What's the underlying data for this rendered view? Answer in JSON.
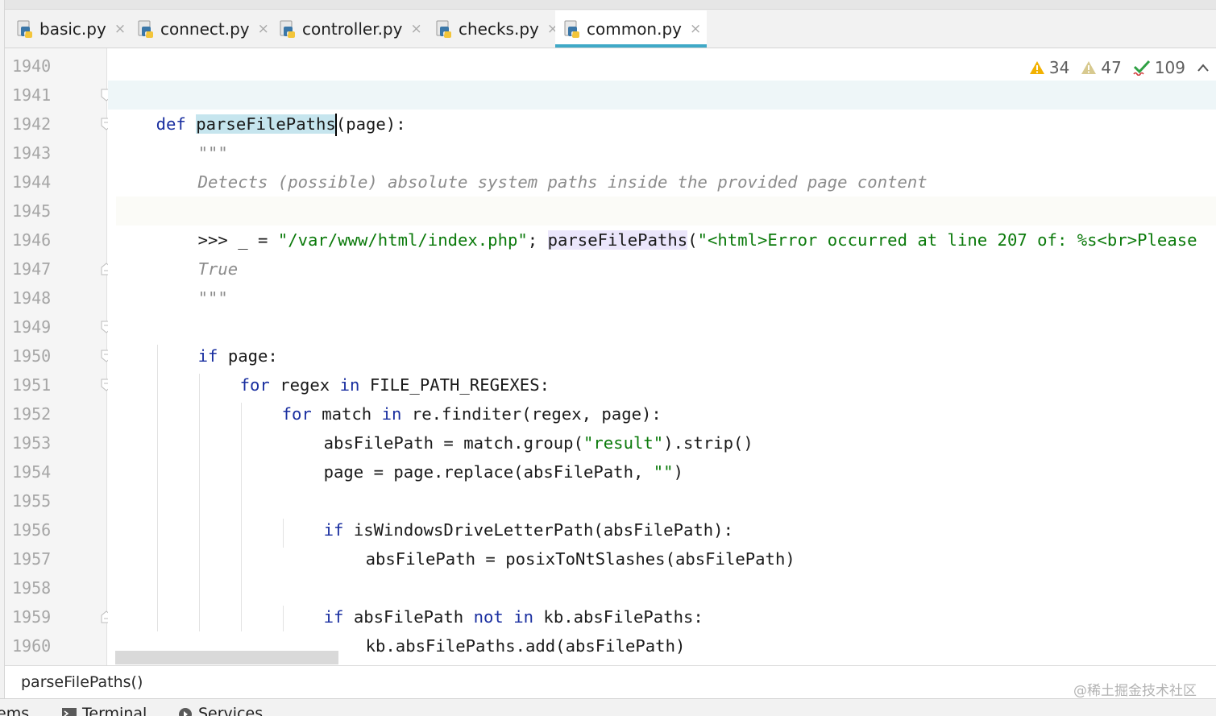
{
  "tabs": [
    {
      "label": "basic.py",
      "active": false
    },
    {
      "label": "connect.py",
      "active": false
    },
    {
      "label": "controller.py",
      "active": false
    },
    {
      "label": "checks.py",
      "active": false
    },
    {
      "label": "common.py",
      "active": true
    }
  ],
  "tab_close_glyph": "×",
  "gutter": {
    "line_numbers": [
      "1940",
      "1941",
      "1942",
      "1943",
      "1944",
      "1945",
      "1946",
      "1947",
      "1948",
      "1949",
      "1950",
      "1951",
      "1952",
      "1953",
      "1954",
      "1955",
      "1956",
      "1957",
      "1958",
      "1959",
      "1960"
    ]
  },
  "inspections": {
    "warnings": "34",
    "weak_warnings": "47",
    "typos": "109",
    "collapse_glyph": "^"
  },
  "code": {
    "l1941": {
      "kw": "def",
      "fname": "parseFilePaths",
      "rest": "(page):"
    },
    "l1942": "\"\"\"",
    "l1943": "Detects (possible) absolute system paths inside the provided page content",
    "l1945": {
      "prompt": ">>> _ = ",
      "str1": "\"/var/www/html/index.php\"",
      "sep": "; ",
      "fname": "parseFilePaths",
      "paren": "(",
      "str2": "\"<html>Error occurred at line 207 of: %s<br>Please"
    },
    "l1946": "True",
    "l1947": "\"\"\"",
    "l1949": {
      "kw": "if",
      "rest": " page:"
    },
    "l1950": {
      "kw1": "for",
      "mid": " regex ",
      "kw2": "in",
      "rest": " FILE_PATH_REGEXES:"
    },
    "l1951": {
      "kw1": "for",
      "mid": " match ",
      "kw2": "in",
      "rest": " re.finditer(regex, page):"
    },
    "l1952": {
      "pre": "absFilePath = match.group(",
      "str": "\"result\"",
      "post": ").strip()"
    },
    "l1953": {
      "pre": "page = page.replace(absFilePath, ",
      "str": "\"\"",
      "post": ")"
    },
    "l1955": {
      "kw": "if",
      "rest": " isWindowsDriveLetterPath(absFilePath):"
    },
    "l1956": "absFilePath = posixToNtSlashes(absFilePath)",
    "l1958": {
      "kw1": "if",
      "mid": " absFilePath ",
      "kw2": "not in",
      "rest": " kb.absFilePaths:"
    },
    "l1959": "kb.absFilePaths.add(absFilePath)"
  },
  "breadcrumb": {
    "label": "parseFilePaths()"
  },
  "watermark": "@稀土掘金技术社区",
  "tool_windows": [
    {
      "label": "ems"
    },
    {
      "label": "Terminal"
    },
    {
      "label": "Services"
    }
  ],
  "colors": {
    "keyword": "#1a2fa0",
    "string": "#0b7a0b",
    "docstring": "#8c8c8c",
    "active_tab_underline": "#3fa9c7",
    "caret_line": "#eef6f8",
    "warning": "#f2b100"
  }
}
